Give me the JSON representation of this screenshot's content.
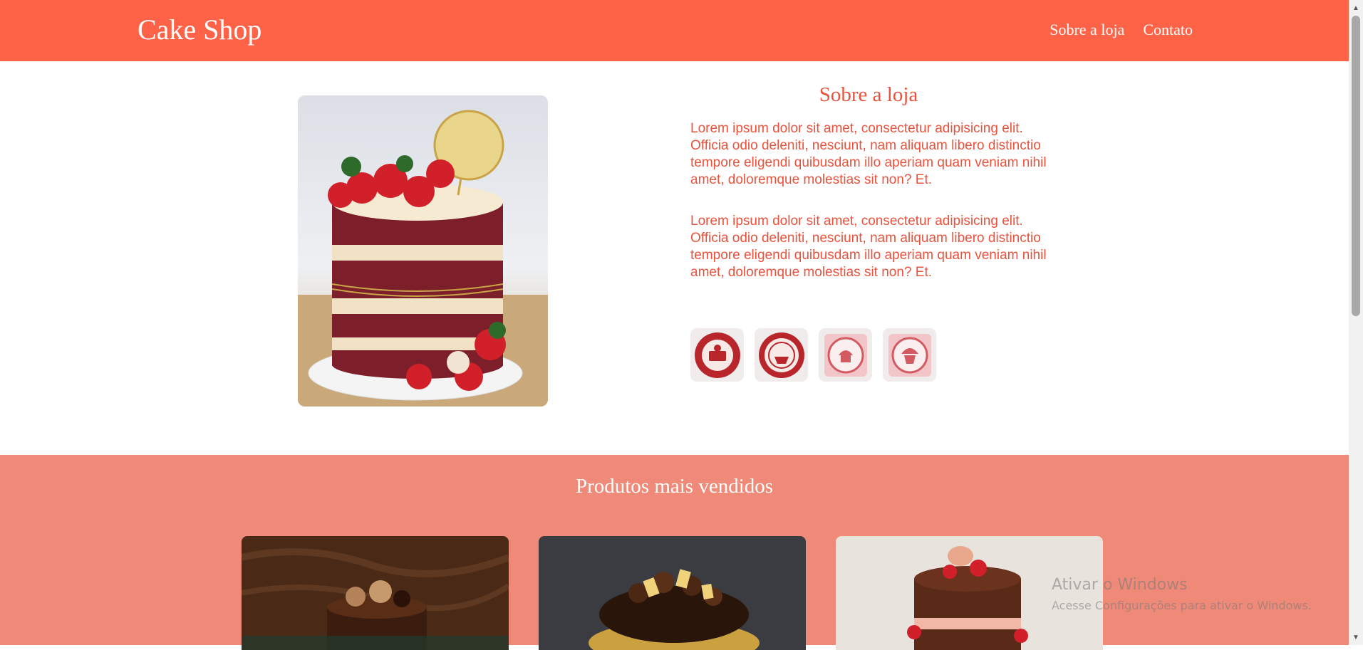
{
  "header": {
    "logo": "Cake Shop",
    "nav": [
      {
        "label": "Sobre a loja"
      },
      {
        "label": "Contato"
      }
    ]
  },
  "about": {
    "title": "Sobre a loja",
    "paragraphs": [
      "Lorem ipsum dolor sit amet, consectetur adipisicing elit. Officia odio deleniti, nesciunt, nam aliquam libero distinctio tempore eligendi quibusdam illo aperiam quam veniam nihil amet, doloremque molestias sit non? Et.",
      "Lorem ipsum dolor sit amet, consectetur adipisicing elit. Officia odio deleniti, nesciunt, nam aliquam libero distinctio tempore eligendi quibusdam illo aperiam quam veniam nihil amet, doloremque molestias sit non? Et."
    ],
    "image_icon": "red-velvet-cake-image"
  },
  "products": {
    "title": "Produtos mais vendidos",
    "items": [
      {
        "icon": "chocolate-drip-cake-image"
      },
      {
        "icon": "chocolate-truffle-cake-image"
      },
      {
        "icon": "strawberry-chocolate-cake-image"
      }
    ]
  },
  "watermark": {
    "line1": "Ativar o Windows",
    "line2": "Acesse Configurações para ativar o Windows."
  },
  "colors": {
    "brand": "#ff6347",
    "section_bg": "#f08a78",
    "text_accent": "#e9533d"
  }
}
